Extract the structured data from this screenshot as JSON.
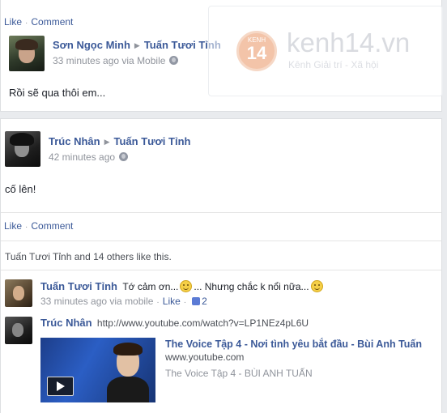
{
  "post1": {
    "actions": {
      "like": "Like",
      "comment": "Comment"
    },
    "author": "Sơn Ngọc Minh",
    "target": "Tuấn Tươi Tỉnh",
    "time": "33 minutes ago via Mobile",
    "text": "Rồi sẽ qua thôi em..."
  },
  "watermark": {
    "badge_top": "KENH",
    "badge_num": "14",
    "site": "kenh14.vn",
    "tagline": "Kênh Giải trí - Xã hội"
  },
  "post2": {
    "author": "Trúc Nhân",
    "target": "Tuấn Tươi Tỉnh",
    "time": "42 minutes ago",
    "text": "cố lên!",
    "actions": {
      "like": "Like",
      "comment": "Comment"
    },
    "likes_summary": "Tuấn Tươi Tỉnh and 14 others like this."
  },
  "comments": [
    {
      "author": "Tuấn Tươi Tỉnh",
      "text_part1": "Tớ cảm ơn...",
      "text_part2": "... Nhưng chắc k nổi nữa...",
      "time": "33 minutes ago via mobile",
      "like": "Like",
      "like_count": "2"
    },
    {
      "author": "Trúc Nhân",
      "url": "http://www.youtube.com/watch?v=LP1NEz4pL6U",
      "video": {
        "title": "The Voice Tập 4 - Nơi tình yêu bắt đầu - Bùi Anh Tuấn",
        "domain": "www.youtube.com",
        "description": "The Voice Tập 4 - BÙI ANH TUẤN"
      }
    }
  ]
}
